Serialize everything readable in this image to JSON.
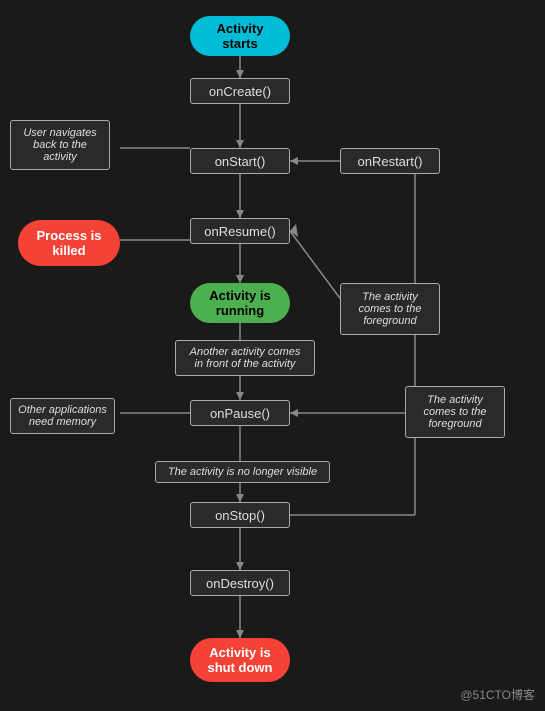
{
  "nodes": {
    "activity_starts": {
      "label": "Activity\nstarts"
    },
    "onCreate": {
      "label": "onCreate()"
    },
    "onStart": {
      "label": "onStart()"
    },
    "onRestart": {
      "label": "onRestart()"
    },
    "onResume": {
      "label": "onResume()"
    },
    "activity_running": {
      "label": "Activity is\nrunning"
    },
    "onPause": {
      "label": "onPause()"
    },
    "onStop": {
      "label": "onStop()"
    },
    "onDestroy": {
      "label": "onDestroy()"
    },
    "activity_shutdown": {
      "label": "Activity is\nshut down"
    }
  },
  "notes": {
    "user_navigates": {
      "label": "User navigates\nback to the\nactivity"
    },
    "process_killed": {
      "label": "Process is\nkilled"
    },
    "another_activity": {
      "label": "Another activity comes\nin front of the activity"
    },
    "other_applications": {
      "label": "Other applications\nneed memory"
    },
    "no_longer_visible": {
      "label": "The activity is no longer visible"
    },
    "activity_foreground_1": {
      "label": "The activity\ncomes to the\nforeground"
    },
    "activity_foreground_2": {
      "label": "The activity\ncomes to the\nforeground"
    }
  },
  "watermark": "@51CTO博客",
  "colors": {
    "cyan": "#00bcd4",
    "green": "#4caf50",
    "red": "#f44336",
    "rect_border": "#aaaaaa",
    "rect_bg": "#2e2e2e",
    "text_light": "#dddddd",
    "line_color": "#888888",
    "background": "#1a1a1a"
  }
}
